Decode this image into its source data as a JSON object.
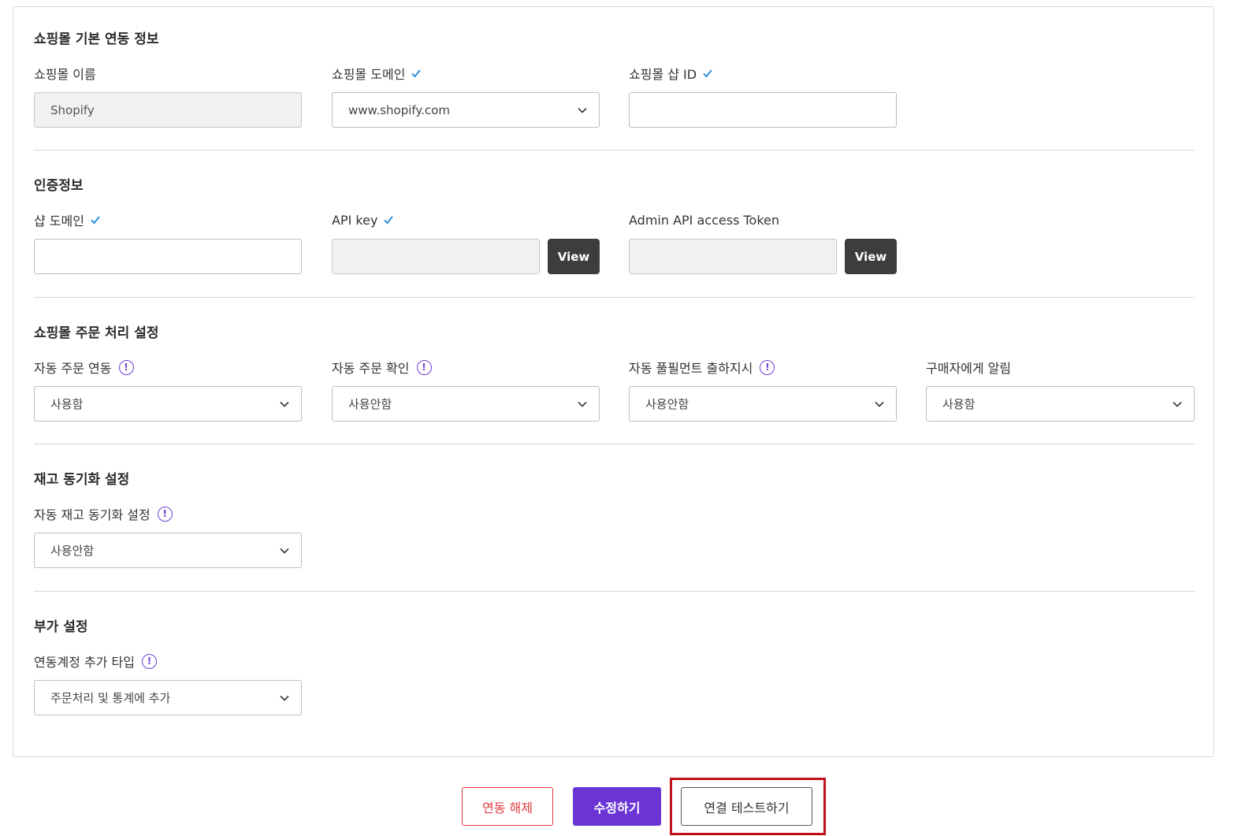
{
  "sections": {
    "basic": {
      "title": "쇼핑몰 기본 연동 정보",
      "mall_name": {
        "label": "쇼핑몰 이름",
        "value": "Shopify"
      },
      "mall_domain": {
        "label": "쇼핑몰 도메인",
        "value": "www.shopify.com"
      },
      "shop_id": {
        "label": "쇼핑몰 샵 ID",
        "value": ""
      }
    },
    "auth": {
      "title": "인증정보",
      "shop_domain": {
        "label": "샵 도메인",
        "value": ""
      },
      "api_key": {
        "label": "API key",
        "value": "",
        "button": "View"
      },
      "admin_token": {
        "label": "Admin API access Token",
        "value": "",
        "button": "View"
      }
    },
    "order": {
      "title": "쇼핑몰 주문 처리 설정",
      "auto_order_link": {
        "label": "자동 주문 연동",
        "value": "사용함"
      },
      "auto_order_confirm": {
        "label": "자동 주문 확인",
        "value": "사용안함"
      },
      "auto_fulfillment": {
        "label": "자동 풀필먼트 출하지시",
        "value": "사용안함"
      },
      "notify_buyer": {
        "label": "구매자에게 알림",
        "value": "사용함"
      }
    },
    "inventory": {
      "title": "재고 동기화 설정",
      "auto_sync": {
        "label": "자동 재고 동기화 설정",
        "value": "사용안함"
      }
    },
    "extra": {
      "title": "부가 설정",
      "account_type": {
        "label": "연동계정 추가 타입",
        "value": "주문처리 및 통계에 추가"
      }
    }
  },
  "footer": {
    "unlink": "연동 해제",
    "edit": "수정하기",
    "test": "연결 테스트하기"
  },
  "icons": {
    "check": "check-icon",
    "info": "info-icon",
    "dropdown": "chevron-down-icon"
  },
  "colors": {
    "accent": "#6b35d6",
    "check": "#2f8fd8",
    "danger": "#e0393e",
    "highlight": "#c0101a",
    "dark_button": "#3d3d3d"
  }
}
